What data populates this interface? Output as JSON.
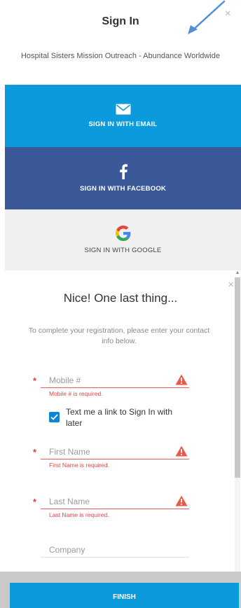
{
  "signin": {
    "title": "Sign In",
    "org_name": "Hospital Sisters Mission Outreach - Abundance Worldwide",
    "close_glyph": "×",
    "providers": {
      "email": {
        "label": "SIGN IN WITH EMAIL",
        "icon": "envelope-icon",
        "color": "#0b9bdc"
      },
      "facebook": {
        "label": "SIGN IN WITH FACEBOOK",
        "icon": "facebook-icon",
        "color": "#3b5998"
      },
      "google": {
        "label": "SIGN IN WITH GOOGLE",
        "icon": "google-icon",
        "color": "#f0f0f0"
      }
    }
  },
  "registration": {
    "title": "Nice! One last thing...",
    "instructions": "To complete your registration, please enter your contact info below.",
    "close_glyph": "×",
    "fields": {
      "mobile": {
        "placeholder": "Mobile #",
        "value": "",
        "required": true,
        "error": "Mobile # is required."
      },
      "first_name": {
        "placeholder": "First Name",
        "value": "",
        "required": true,
        "error": "First Name is required."
      },
      "last_name": {
        "placeholder": "Last Name",
        "value": "",
        "required": true,
        "error": "Last Name is required."
      },
      "company": {
        "placeholder": "Company",
        "value": "",
        "required": false
      }
    },
    "sms_opt_in": {
      "label": "Text me a link to Sign In with later",
      "checked": true
    },
    "finish_label": "FINISH"
  },
  "colors": {
    "accent": "#0b9bdc",
    "error": "#e04646",
    "checkbox": "#0b86d2"
  }
}
